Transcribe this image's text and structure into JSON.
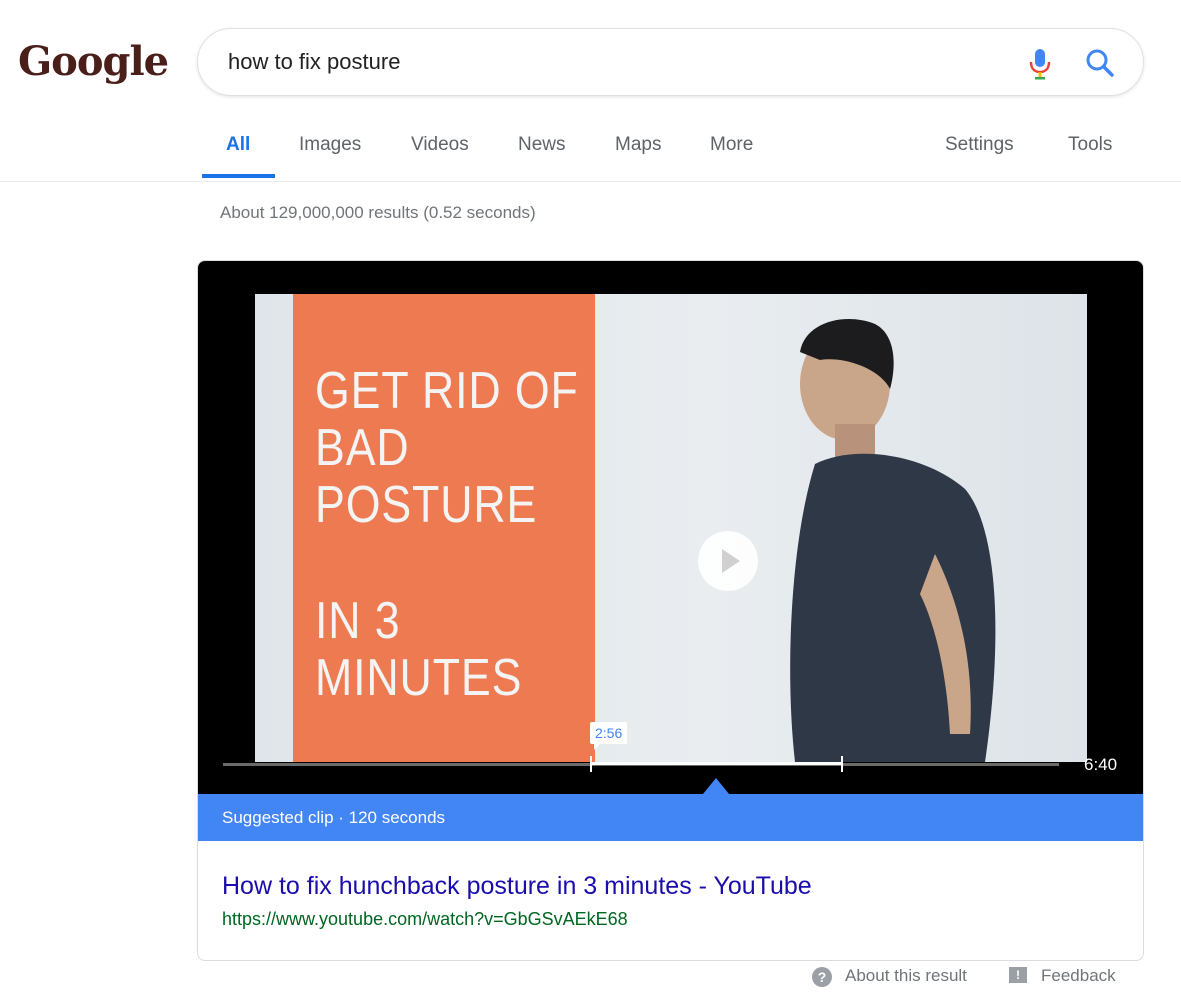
{
  "logo": {
    "text": "Google"
  },
  "search": {
    "query": "how to fix posture"
  },
  "icons": {
    "mic": "mic-icon",
    "search": "search-icon",
    "play": "play-icon",
    "help": "help-icon",
    "feedback": "feedback-icon"
  },
  "tabs": [
    {
      "label": "All",
      "active": true
    },
    {
      "label": "Images"
    },
    {
      "label": "Videos"
    },
    {
      "label": "News"
    },
    {
      "label": "Maps"
    },
    {
      "label": "More"
    },
    {
      "label": "Settings"
    },
    {
      "label": "Tools"
    }
  ],
  "result_stats": "About 129,000,000 results (0.52 seconds)",
  "video": {
    "thumbnail_text": [
      "GET RID OF",
      "BAD",
      "POSTURE",
      "IN 3",
      "MINUTES"
    ],
    "clip_start_label": "2:56",
    "duration_label": "6:40",
    "clip_start_fraction": 0.44,
    "clip_end_fraction": 0.74
  },
  "suggested_clip": "Suggested clip · 120 seconds",
  "result": {
    "title": "How to fix hunchback posture in 3 minutes - YouTube",
    "url": "https://www.youtube.com/watch?v=GbGSvAEkE68"
  },
  "footer": {
    "about": "About this result",
    "feedback": "Feedback"
  },
  "colors": {
    "accent": "#1a73e8",
    "clip_bar": "#4285f4",
    "link": "#1a0dab",
    "url": "#006621",
    "orange": "#ee7a52"
  }
}
